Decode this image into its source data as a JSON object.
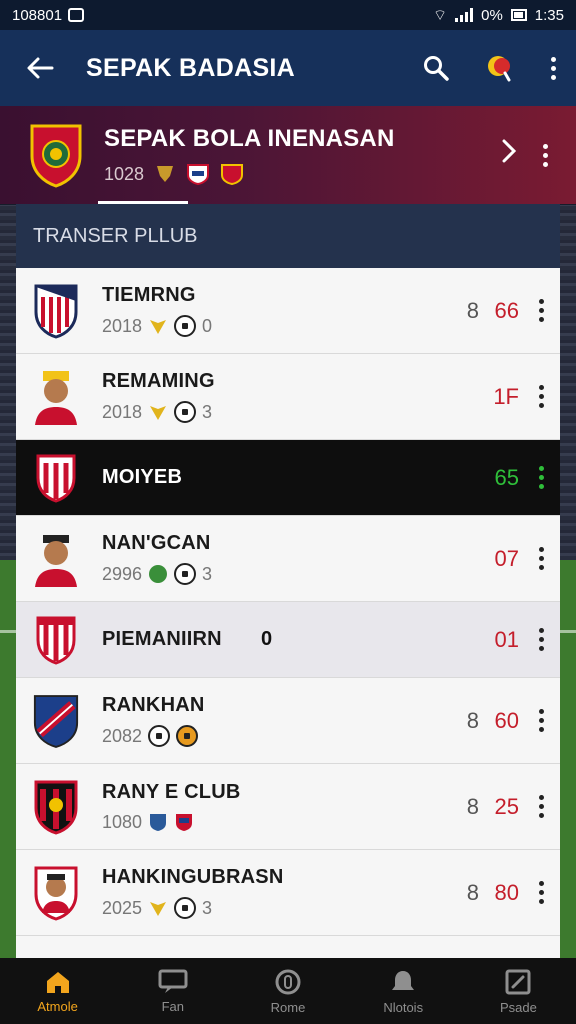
{
  "status_bar": {
    "time_left": "108801",
    "battery": "0%",
    "time_right": "1:35"
  },
  "app_bar": {
    "title": "SEPAK BADASIA"
  },
  "hero": {
    "name": "SEPAK BOLA INENASAN",
    "year": "1028"
  },
  "section": {
    "title": "TRANSER PLLUB"
  },
  "rows": [
    {
      "name": "TIEMRNG",
      "year": "2018",
      "aux": "8",
      "value": "66",
      "extra": "0"
    },
    {
      "name": "REMAMING",
      "year": "2018",
      "aux": "",
      "value": "1F",
      "extra": "3"
    },
    {
      "name": "MOIYEB",
      "year": "",
      "aux": "",
      "value": "65",
      "extra": ""
    },
    {
      "name": "NAN'GCAN",
      "year": "2996",
      "aux": "",
      "value": "07",
      "extra": "3"
    },
    {
      "name": "PIEMANIIRN",
      "year": "",
      "aux": "",
      "value": "01",
      "extra": "",
      "mid": "0"
    },
    {
      "name": "RANKHAN",
      "year": "2082",
      "aux": "8",
      "value": "60",
      "extra": ""
    },
    {
      "name": "RANY E CLUB",
      "year": "1080",
      "aux": "8",
      "value": "25",
      "extra": ""
    },
    {
      "name": "HANKINGUBRASN",
      "year": "2025",
      "aux": "8",
      "value": "80",
      "extra": "3"
    }
  ],
  "bottom_nav": [
    {
      "label": "Atmole",
      "icon": "home-icon",
      "active": true
    },
    {
      "label": "Fan",
      "icon": "chat-icon",
      "active": false
    },
    {
      "label": "Rome",
      "icon": "circle-icon",
      "active": false
    },
    {
      "label": "Nlotois",
      "icon": "bell-icon",
      "active": false
    },
    {
      "label": "Psade",
      "icon": "edit-icon",
      "active": false
    }
  ],
  "colors": {
    "app_bar": "#16305a",
    "score_red": "#c41e2b",
    "score_green": "#2fbf3a",
    "nav_active": "#f2a51d"
  }
}
